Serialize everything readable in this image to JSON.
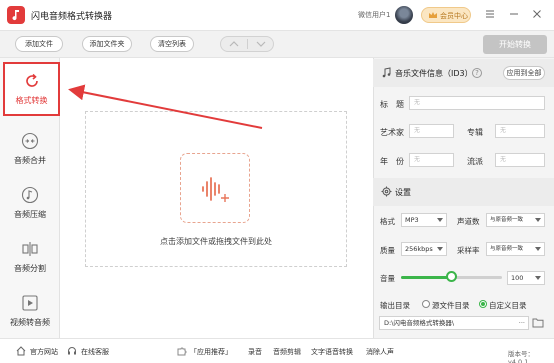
{
  "app": {
    "title": "闪电音频格式转换器",
    "user": "微信用户1",
    "vip_label": "会员中心"
  },
  "toolbar": {
    "add_file": "添加文件",
    "add_folder": "添加文件夹",
    "clear_list": "清空列表",
    "start": "开始转换"
  },
  "sidebar": {
    "items": [
      {
        "label": "格式转换",
        "icon": "refresh-icon",
        "active": true
      },
      {
        "label": "音频合并",
        "icon": "merge-icon",
        "active": false
      },
      {
        "label": "音频压缩",
        "icon": "music-note-icon",
        "active": false
      },
      {
        "label": "音频分割",
        "icon": "split-icon",
        "active": false
      },
      {
        "label": "视频转音频",
        "icon": "video-play-icon",
        "active": false
      }
    ]
  },
  "dropzone": {
    "hint": "点击添加文件或拖拽文件到此处"
  },
  "info": {
    "title": "音乐文件信息（ID3）",
    "help": "?",
    "apply_all": "应用到全部",
    "fields": {
      "title_label": "标　题",
      "artist_label": "艺术家",
      "album_label": "专辑",
      "year_label": "年　份",
      "genre_label": "流派",
      "placeholder": "无"
    }
  },
  "settings": {
    "title": "设置",
    "format_label": "格式",
    "format_value": "MP3",
    "channel_label": "声道数",
    "channel_value": "与原音频一致",
    "quality_label": "质量",
    "quality_value": "256kbps",
    "sample_label": "采样率",
    "sample_value": "与原音频一致",
    "volume_label": "音量",
    "volume_value": "100",
    "volume_fraction": 0.5,
    "output_label": "输出目录",
    "output_source": "源文件目录",
    "output_custom": "自定义目录",
    "output_path": "D:\\闪电音频格式转换器\\",
    "dots": "···"
  },
  "statusbar": {
    "website": "官方网站",
    "support": "在线客服",
    "recommend": "「应用推荐」",
    "record": "录音",
    "edit": "音频剪辑",
    "stt": "文字语音转换",
    "vocal": "消除人声",
    "version": "版本号：v4.0.1"
  },
  "colors": {
    "accent": "#e23b3b",
    "green": "#3bb54a"
  }
}
